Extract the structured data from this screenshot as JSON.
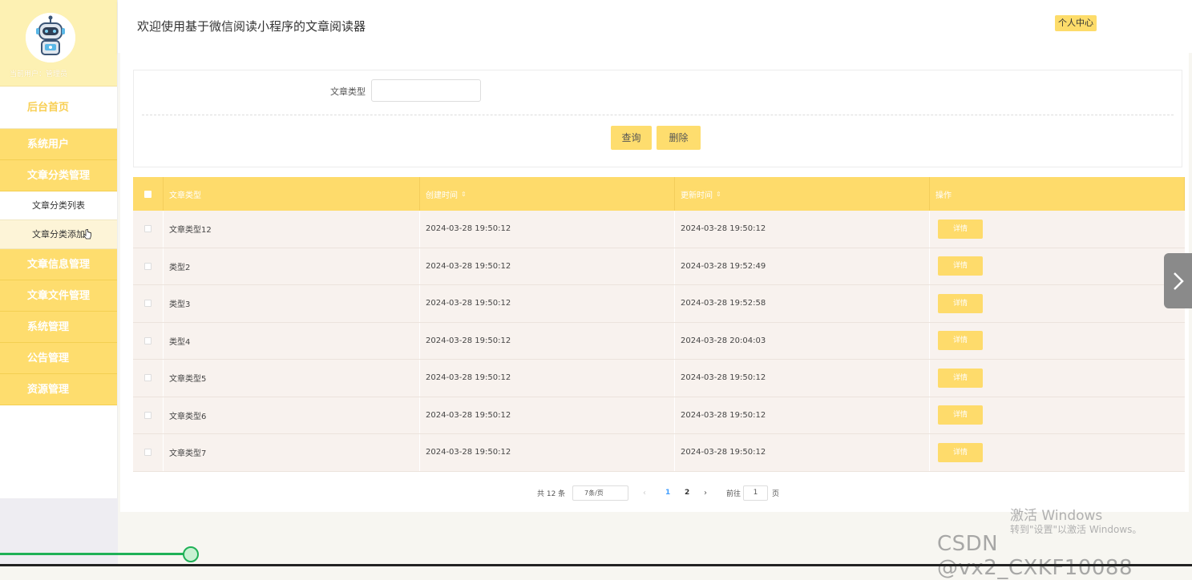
{
  "sidebar": {
    "current_user": "当前用户：管理员",
    "home": "后台首页",
    "menu": [
      {
        "label": "系统用户"
      },
      {
        "label": "文章分类管理"
      },
      {
        "label": "文章信息管理"
      },
      {
        "label": "文章文件管理"
      },
      {
        "label": "系统管理"
      },
      {
        "label": "公告管理"
      },
      {
        "label": "资源管理"
      }
    ],
    "submenu": [
      {
        "label": "文章分类列表"
      },
      {
        "label": "文章分类添加"
      }
    ]
  },
  "header": {
    "title": "欢迎使用基于微信阅读小程序的文章阅读器",
    "personal_center": "个人中心"
  },
  "search": {
    "label": "文章类型",
    "value": "",
    "query_button": "查询",
    "delete_button": "删除"
  },
  "table": {
    "columns": [
      "文章类型",
      "创建时间",
      "更新时间",
      "操作"
    ],
    "sortable": [
      false,
      true,
      true,
      false
    ],
    "action_label": "详情",
    "rows": [
      [
        "文章类型12",
        "2024-03-28 19:50:12",
        "2024-03-28 19:50:12"
      ],
      [
        "类型2",
        "2024-03-28 19:50:12",
        "2024-03-28 19:52:49"
      ],
      [
        "类型3",
        "2024-03-28 19:50:12",
        "2024-03-28 19:52:58"
      ],
      [
        "类型4",
        "2024-03-28 19:50:12",
        "2024-03-28 20:04:03"
      ],
      [
        "文章类型5",
        "2024-03-28 19:50:12",
        "2024-03-28 19:50:12"
      ],
      [
        "文章类型6",
        "2024-03-28 19:50:12",
        "2024-03-28 19:50:12"
      ],
      [
        "文章类型7",
        "2024-03-28 19:50:12",
        "2024-03-28 19:50:12"
      ]
    ]
  },
  "pagination": {
    "total": "共 12 条",
    "page_size": "7条/页",
    "pages": [
      "1",
      "2"
    ],
    "current_page": "1",
    "goto_label": "前往",
    "goto_value": "1",
    "goto_unit": "页"
  },
  "overlay": {
    "activate_title": "激活 Windows",
    "activate_sub": "转到\"设置\"以激活 Windows。",
    "csdn": "CSDN @vx2_CXKF10088"
  },
  "video": {
    "progress_fraction": 0.16
  },
  "colors": {
    "accent": "#fedd6e",
    "profile_bg": "#fdf1b3",
    "progress": "#1fb157"
  }
}
